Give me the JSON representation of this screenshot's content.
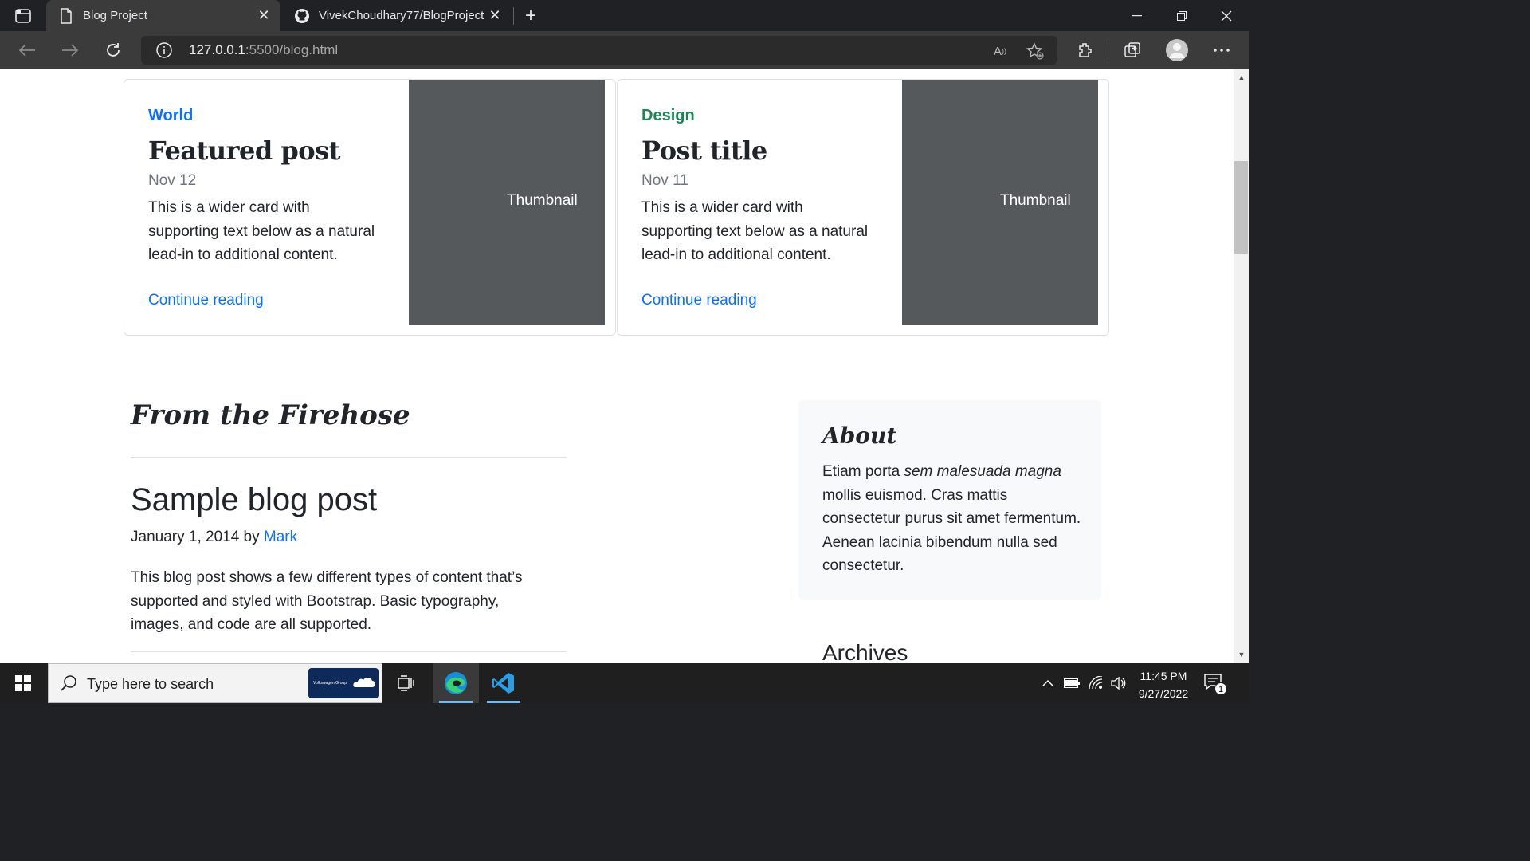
{
  "browser": {
    "tabs": [
      {
        "title": "Blog Project",
        "active": true
      },
      {
        "title": "VivekChoudhary77/BlogProject: ",
        "active": false
      }
    ],
    "url_host": "127.0.0.1",
    "url_path": ":5500/blog.html"
  },
  "cards": [
    {
      "category": "World",
      "category_color": "#0d6efd",
      "title": "Featured post",
      "date": "Nov 12",
      "text": "This is a wider card with supporting text below as a natural lead-in to additional content.",
      "link": "Continue reading",
      "thumb": "Thumbnail"
    },
    {
      "category": "Design",
      "category_color": "#198754",
      "title": "Post title",
      "date": "Nov 11",
      "text": "This is a wider card with supporting text below as a natural lead-in to additional content.",
      "link": "Continue reading",
      "thumb": "Thumbnail"
    }
  ],
  "main": {
    "section_title": "From the Firehose",
    "post_title": "Sample blog post",
    "post_date": "January 1, 2014 by ",
    "post_author": "Mark",
    "post_body": "This blog post shows a few different types of content that’s supported and styled with Bootstrap. Basic typography, images, and code are all supported."
  },
  "sidebar": {
    "about_title": "About",
    "about_text_1": "Etiam porta ",
    "about_text_em": "sem malesuada magna",
    "about_text_2": " mollis euismod. Cras mattis consectetur purus sit amet fermentum. Aenean lacinia bibendum nulla sed consectetur.",
    "archives_title": "Archives"
  },
  "taskbar": {
    "search_placeholder": "Type here to search",
    "promo_text": "Volkswagen Group",
    "time": "11:45 PM",
    "date": "9/27/2022",
    "notification_count": "1"
  }
}
